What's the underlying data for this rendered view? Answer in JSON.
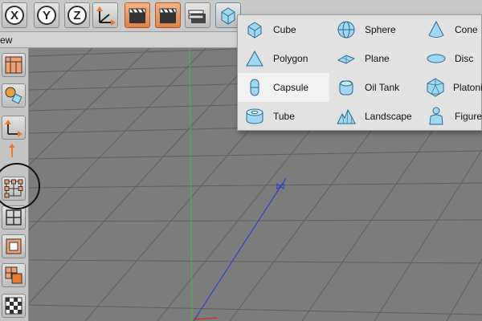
{
  "toolbar": {
    "axis_x": "X",
    "axis_y": "Y",
    "axis_z": "Z"
  },
  "menubar": {
    "view_label": "ew"
  },
  "primitives_menu": {
    "selected": "Capsule",
    "columns": [
      [
        {
          "label": "Cube",
          "icon": "cube-icon"
        },
        {
          "label": "Polygon",
          "icon": "polygon-icon"
        },
        {
          "label": "Capsule",
          "icon": "capsule-icon"
        },
        {
          "label": "Tube",
          "icon": "tube-icon"
        }
      ],
      [
        {
          "label": "Sphere",
          "icon": "sphere-icon"
        },
        {
          "label": "Plane",
          "icon": "plane-icon"
        },
        {
          "label": "Oil Tank",
          "icon": "oil-tank-icon"
        },
        {
          "label": "Landscape",
          "icon": "landscape-icon"
        }
      ],
      [
        {
          "label": "Cone",
          "icon": "cone-icon"
        },
        {
          "label": "Disc",
          "icon": "disc-icon"
        },
        {
          "label": "Platonic",
          "icon": "platonic-icon"
        },
        {
          "label": "Figure",
          "icon": "figure-icon"
        }
      ]
    ]
  },
  "colors": {
    "icon_fill": "#9fd8f0",
    "icon_stroke": "#2a6a8a",
    "accent_orange": "#e0824a",
    "grid_line": "#5f5f5f",
    "axis_y": "#4caf50",
    "axis_z": "#3040c0"
  }
}
